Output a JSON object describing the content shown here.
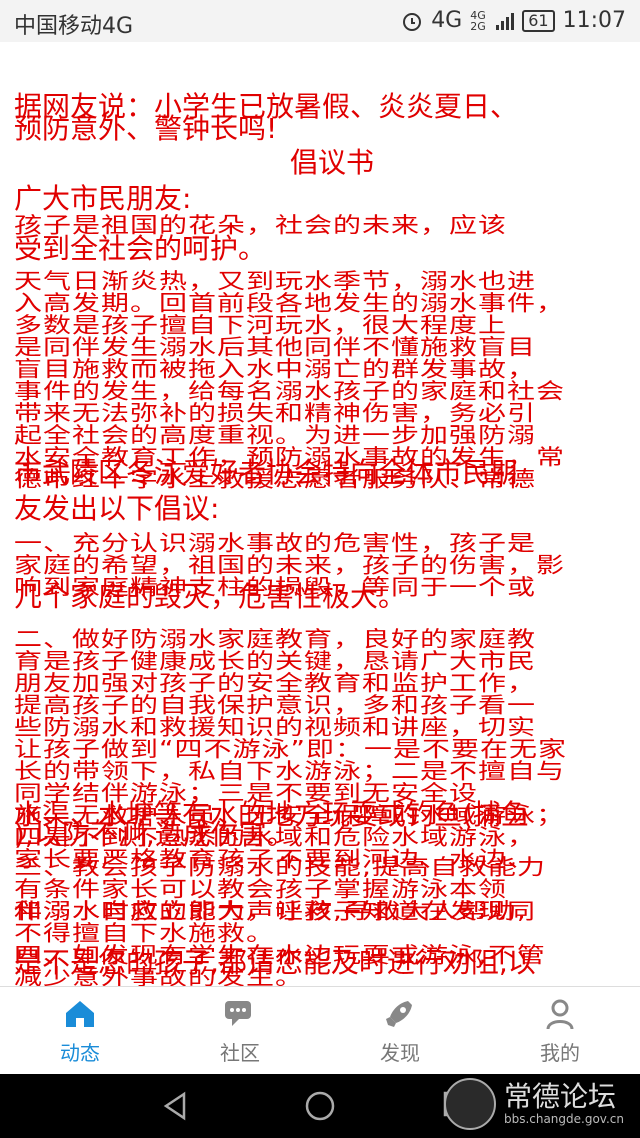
{
  "status": {
    "carrier": "中国移动4G",
    "net": "4G",
    "net_small": "4G 2G",
    "battery": "61",
    "time": "11:07"
  },
  "article": {
    "lines": [
      "据网友说：小学生已放暑假、炎炎夏日、",
      "预防意外、警钟长鸣!",
      "倡议书",
      "广大市民朋友:",
      "孩子是祖国的花朵，社会的未来，应该",
      "受到全社会的呵护。",
      "天气日渐炎热，又到玩水季节，溺水也进",
      "入高发期。回首前段各地发生的溺水事件，",
      "多数是孩子擅自下河玩水，很大程度上",
      "是同伴发生溺水后其他同伴不懂施救盲目",
      "盲目施救而被拖入水中溺亡的群发事故，",
      "事件的发生，给每名溺水孩子的家庭和社会",
      "带来无法弥补的损失和精神伤害，务必引",
      "起全社会的高度重视。为进一步加强防溺",
      "水安全教育工作，预防溺水事故的发生，常",
      "德市红十字水上救援志愿者服务队、常德",
      "市武陵区冬泳爱好者协会特向全体市民朋",
      "友发出以下倡议:",
      "一、充分认识溺水事故的危害性，孩子是",
      "家庭的希望，祖国的未来，孩子的伤害，影",
      "响到家庭精神支柱的损毁，等同于一个或",
      "几个家庭的毁灭，危害性极大。",
      "二、做好防溺水家庭教育，良好的家庭教",
      "育是孩子健康成长的关键，恳请广大市民",
      "朋友加强对孩子的安全教育和监护工作，",
      "提高孩子的自我保护意识，多和孩子看一",
      "些防溺水和救援知识的视频和讲座，切实",
      "让孩子做到“四不游泳”即：一是不要在无家",
      "长的带领下，私自下水游泳；二是不擅自与",
      "同学结伴游泳；三是不要到无安全设",
      "施、无救护人员、无安全保障的水域游泳；",
      "四是不到不熟悉的水域和危险水域游泳，",
      "家长要严格教育孩子不要到河边、水边、",
      "水渠、水塘等有水的地方玩耍或钓鱼(捕鱼",
      "),以防不测,造成伤害。",
      "三、教会孩子防溺水的技能,提高自救能力",
      "有条件家长可以教会孩子掌握游泳本领",
      "和溺水自救的能力，让孩子知道在发现同",
      "伴溺水时应立即大声呼救,寻救大人帮助,",
      "不得擅自下水施救。",
      "四、如发现有学生在水边玩耍或游泳,不管",
      "是不是您的孩子,都请您能及时进行劝阻,以",
      "减少意外事故的发生。"
    ]
  },
  "tabs": [
    {
      "label": "动态",
      "icon": "home-icon"
    },
    {
      "label": "社区",
      "icon": "chat-icon"
    },
    {
      "label": "发现",
      "icon": "rocket-icon"
    },
    {
      "label": "我的",
      "icon": "user-icon"
    }
  ],
  "watermark": {
    "title": "常德论坛",
    "url": "bbs.changde.gov.cn"
  },
  "colors": {
    "text": "#e00000",
    "accent": "#1a8cd8"
  }
}
